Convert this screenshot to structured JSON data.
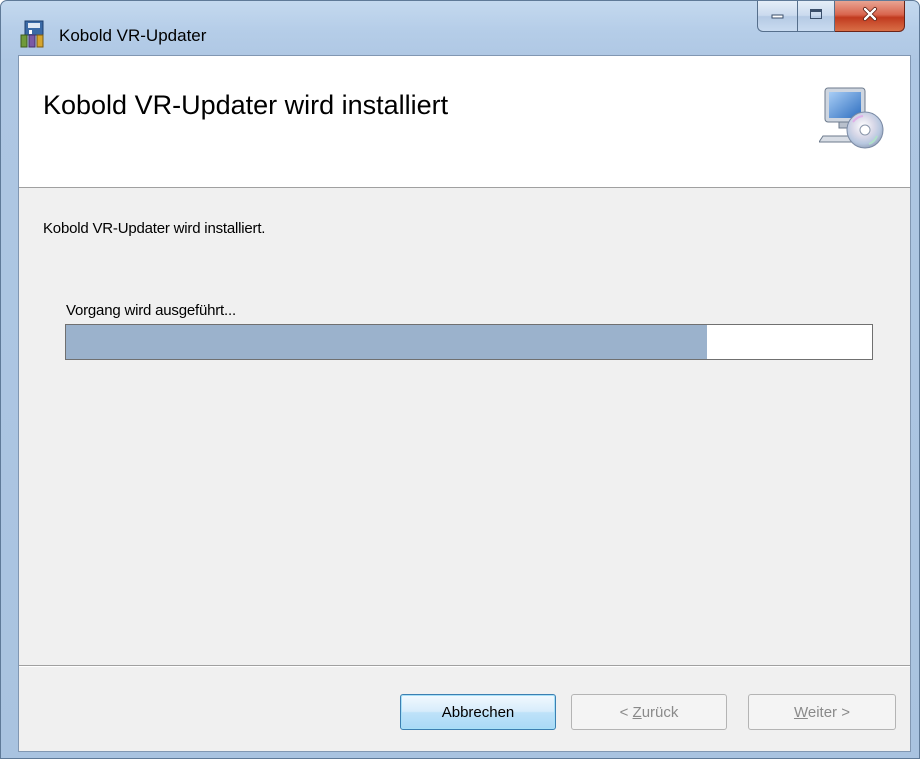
{
  "window": {
    "title": "Kobold VR-Updater",
    "icon": "installer-app-icon",
    "caption_buttons": [
      "minimize-icon",
      "maximize-icon",
      "close-icon"
    ]
  },
  "banner": {
    "title": "Kobold VR-Updater wird installiert",
    "icon": "computer-cd-icon"
  },
  "content": {
    "description": "Kobold VR-Updater wird installiert.",
    "status": "Vorgang wird ausgeführt...",
    "progress_fraction": 0.795
  },
  "buttons": {
    "cancel": "Abbrechen",
    "back": {
      "prefix": "< ",
      "accel": "Z",
      "rest": "urück"
    },
    "next": {
      "accel": "W",
      "rest": "eiter",
      "suffix": " >"
    }
  },
  "colors": {
    "progress_fill": "#9bb2cc",
    "client_background": "#f0f0f0",
    "close_button": "#c7452a"
  }
}
